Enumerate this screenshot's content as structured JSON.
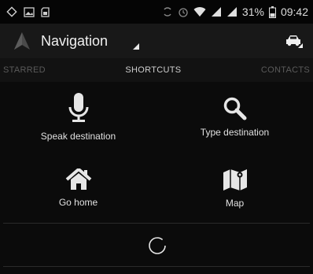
{
  "status_bar": {
    "battery_percent": "31%",
    "time": "09:42",
    "icons": [
      "location-icon",
      "image-icon",
      "sd-card-icon",
      "rotate-icon",
      "alarm-icon",
      "wifi-icon",
      "signal-icon",
      "signal-icon",
      "battery-icon"
    ]
  },
  "action_bar": {
    "title": "Navigation",
    "left_icon": "navigation-arrow-icon",
    "right_icon": "car-icon"
  },
  "tabs": [
    {
      "label": "STARRED",
      "active": false
    },
    {
      "label": "SHORTCUTS",
      "active": true
    },
    {
      "label": "CONTACTS",
      "active": false
    }
  ],
  "shortcuts": [
    {
      "label": "Speak destination",
      "icon": "microphone-icon"
    },
    {
      "label": "Type destination",
      "icon": "search-icon"
    },
    {
      "label": "Go home",
      "icon": "home-icon"
    },
    {
      "label": "Map",
      "icon": "map-icon"
    }
  ],
  "loading_indicator": "loading-spinner"
}
